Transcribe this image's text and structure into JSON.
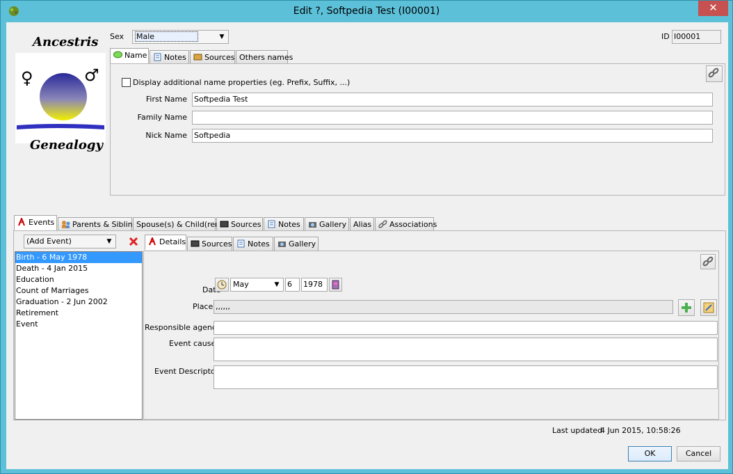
{
  "window": {
    "title": "Edit ?, Softpedia Test (I00001)",
    "close_glyph": "✕"
  },
  "logo": {
    "top_text": "Ancestris",
    "bottom_text": "Genealogy"
  },
  "header": {
    "sex_label": "Sex",
    "sex_value": "Male",
    "id_label": "ID",
    "id_value": "I00001"
  },
  "name_tabs": [
    {
      "label": "Name",
      "icon": "speech-bubble-icon"
    },
    {
      "label": "Notes",
      "icon": "note-icon"
    },
    {
      "label": "Sources",
      "icon": "book-icon"
    },
    {
      "label": "Others names",
      "icon": ""
    }
  ],
  "name_panel": {
    "display_props_label": "Display additional name properties (eg. Prefix, Suffix, ...)",
    "first_name_label": "First Name",
    "first_name_value": "Softpedia Test",
    "family_name_label": "Family Name",
    "family_name_value": "",
    "nick_name_label": "Nick Name",
    "nick_name_value": "Softpedia"
  },
  "main_tabs": [
    {
      "label": "Events",
      "icon": "event-icon"
    },
    {
      "label": "Parents & Sibling",
      "icon": "family-icon"
    },
    {
      "label": "Spouse(s) & Child(ren)",
      "icon": ""
    },
    {
      "label": "Sources",
      "icon": "book-icon"
    },
    {
      "label": "Notes",
      "icon": "note-icon"
    },
    {
      "label": "Gallery",
      "icon": "camera-icon"
    },
    {
      "label": "Alias",
      "icon": ""
    },
    {
      "label": "Associations",
      "icon": "link-icon"
    }
  ],
  "events": {
    "add_event_placeholder": "(Add Event)",
    "items": [
      "Birth - 6 May 1978",
      "Death - 4 Jan 2015",
      "Education",
      "Count of Marriages",
      "Graduation - 2 Jun 2002",
      "Retirement",
      "Event"
    ]
  },
  "detail_tabs": [
    {
      "label": "Details",
      "icon": "event-icon"
    },
    {
      "label": "Sources",
      "icon": "book-icon"
    },
    {
      "label": "Notes",
      "icon": "note-icon"
    },
    {
      "label": "Gallery",
      "icon": "camera-icon"
    }
  ],
  "details": {
    "date_label": "Date",
    "date_month": "May",
    "date_day": "6",
    "date_year": "1978",
    "place_label": "Place",
    "place_value": ",,,,,,",
    "agency_label": "Responsible agency",
    "agency_value": "",
    "cause_label": "Event cause",
    "cause_value": "",
    "descriptor_label": "Event Descriptor",
    "descriptor_value": ""
  },
  "footer": {
    "last_updated_label": "Last updated",
    "last_updated_value": "4 Jun 2015, 10:58:26",
    "ok_label": "OK",
    "cancel_label": "Cancel"
  },
  "colors": {
    "titlebar": "#5cc0d8",
    "selection": "#3399ff",
    "close": "#c75050"
  }
}
